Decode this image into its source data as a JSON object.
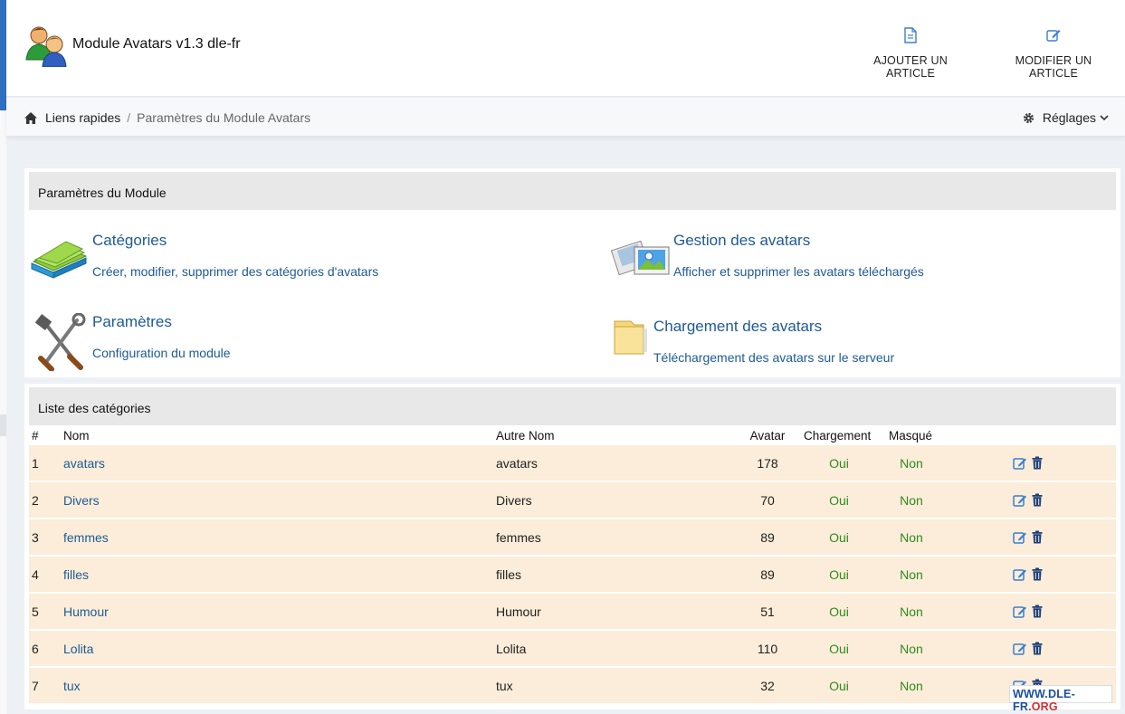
{
  "app": {
    "title": "Module Avatars v1.3 dle-fr",
    "logo_icon": "users-avatar-icon"
  },
  "header": {
    "add_article": "AJOUTER UN ARTICLE",
    "edit_article": "MODIFIER UN ARTICLE"
  },
  "breadcrumb": {
    "home": "Liens rapides",
    "separator": "/",
    "current": "Paramètres du Module Avatars"
  },
  "settings_menu": {
    "label": "Réglages"
  },
  "module_panel": {
    "title": "Paramètres du Module",
    "features": [
      {
        "title": "Catégories",
        "desc": "Créer, modifier, supprimer des catégories d'avatars",
        "icon": "folders-icon"
      },
      {
        "title": "Gestion des avatars",
        "desc": "Afficher et supprimer les avatars téléchargés",
        "icon": "photos-icon"
      },
      {
        "title": "Paramètres",
        "desc": "Configuration du module",
        "icon": "tools-icon"
      },
      {
        "title": "Chargement des avatars",
        "desc": "Téléchargement des avatars sur le serveur",
        "icon": "folder-icon"
      }
    ]
  },
  "categories_panel": {
    "title": "Liste des catégories",
    "columns": [
      "#",
      "Nom",
      "Autre Nom",
      "Avatar",
      "Chargement",
      "Masqué"
    ],
    "rows": [
      {
        "num": "1",
        "nom": "avatars",
        "autre": "avatars",
        "avatar": "178",
        "chargement": "Oui",
        "masque": "Non"
      },
      {
        "num": "2",
        "nom": "Divers",
        "autre": "Divers",
        "avatar": "70",
        "chargement": "Oui",
        "masque": "Non"
      },
      {
        "num": "3",
        "nom": "femmes",
        "autre": "femmes",
        "avatar": "89",
        "chargement": "Oui",
        "masque": "Non"
      },
      {
        "num": "4",
        "nom": "filles",
        "autre": "filles",
        "avatar": "89",
        "chargement": "Oui",
        "masque": "Non"
      },
      {
        "num": "5",
        "nom": "Humour",
        "autre": "Humour",
        "avatar": "51",
        "chargement": "Oui",
        "masque": "Non"
      },
      {
        "num": "6",
        "nom": "Lolita",
        "autre": "Lolita",
        "avatar": "110",
        "chargement": "Oui",
        "masque": "Non"
      },
      {
        "num": "7",
        "nom": "tux",
        "autre": "tux",
        "avatar": "32",
        "chargement": "Oui",
        "masque": "Non"
      }
    ]
  },
  "watermark": {
    "part1": "WWW.DLE-FR",
    "part2": ".ORG"
  },
  "colors": {
    "link": "#1e5a96",
    "yes_no": "#2e8b1e",
    "row_bg": "#fbedd9",
    "panel_head_bg": "#e8e8e8",
    "accent_blue": "#2f6fbf"
  }
}
